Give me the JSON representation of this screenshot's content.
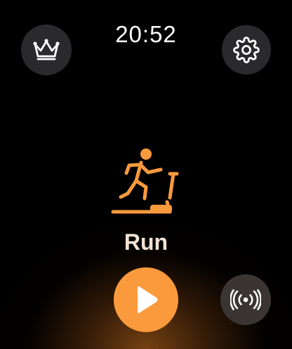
{
  "status_bar": {
    "time": "20:52"
  },
  "header": {
    "crown_icon": "crown-icon",
    "settings_icon": "gear-icon"
  },
  "workout": {
    "icon": "treadmill-runner-icon",
    "label": "Run",
    "accent_color": "#fb9a3d"
  },
  "controls": {
    "start_icon": "play-icon",
    "broadcast_icon": "broadcast-icon"
  }
}
